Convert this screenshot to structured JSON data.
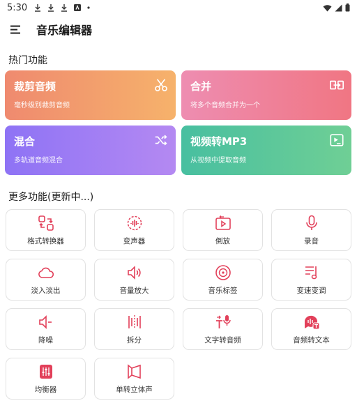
{
  "status_bar": {
    "time": "5:30"
  },
  "app_bar": {
    "title": "音乐编辑器",
    "menu_icon": "menu-icon"
  },
  "hot_section": {
    "title": "热门功能",
    "cards": [
      {
        "title": "裁剪音频",
        "subtitle": "毫秒级别裁剪音频",
        "icon": "scissors-icon"
      },
      {
        "title": "合并",
        "subtitle": "将多个音频合并为一个",
        "icon": "merge-icon"
      },
      {
        "title": "混合",
        "subtitle": "多轨道音频混合",
        "icon": "shuffle-icon"
      },
      {
        "title": "视频转MP3",
        "subtitle": "从视频中提取音频",
        "icon": "video-extract-icon"
      }
    ],
    "colors": [
      "#ef8a6f",
      "#f07683",
      "#8e73f5",
      "#48bfa0"
    ]
  },
  "more_section": {
    "title": "更多功能(更新中...)",
    "tools": [
      {
        "label": "格式转换器",
        "icon": "format-convert-icon"
      },
      {
        "label": "变声器",
        "icon": "voice-changer-icon"
      },
      {
        "label": "倒放",
        "icon": "reverse-play-icon"
      },
      {
        "label": "录音",
        "icon": "microphone-icon"
      },
      {
        "label": "淡入淡出",
        "icon": "cloud-fade-icon"
      },
      {
        "label": "音量放大",
        "icon": "volume-up-icon"
      },
      {
        "label": "音乐标签",
        "icon": "music-tag-icon"
      },
      {
        "label": "变速变调",
        "icon": "speed-pitch-icon"
      },
      {
        "label": "降噪",
        "icon": "noise-reduce-icon"
      },
      {
        "label": "拆分",
        "icon": "split-icon"
      },
      {
        "label": "文字转音频",
        "icon": "text-to-speech-icon"
      },
      {
        "label": "音频转文本",
        "icon": "speech-to-text-icon"
      },
      {
        "label": "均衡器",
        "icon": "equalizer-icon"
      },
      {
        "label": "单转立体声",
        "icon": "mono-to-stereo-icon"
      }
    ],
    "accent": "#e2405a"
  }
}
